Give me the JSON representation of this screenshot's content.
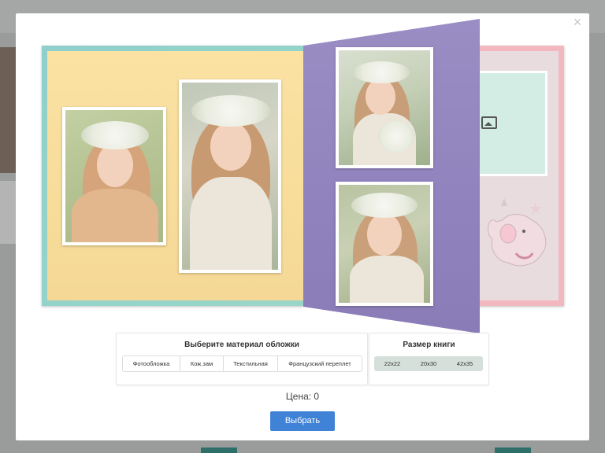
{
  "modal": {
    "close_glyph": "×"
  },
  "material": {
    "title": "Выберите материал обложки",
    "options": [
      "Фотообложка",
      "Кож.зам",
      "Текстильная",
      "Французский переплет"
    ]
  },
  "size": {
    "title": "Размер книги",
    "options": [
      "22x22",
      "20x30",
      "42x35"
    ]
  },
  "price_label": "Цена: 0",
  "choose_label": "Выбрать",
  "colors": {
    "primary_button": "#3f82d6",
    "left_page": "#fbe2a3",
    "flip_page": "#9a8dc4",
    "right_page_border": "#f3b7bf",
    "size_selector_bg": "#d6e0da"
  },
  "icons": {
    "close": "close-icon",
    "image_placeholder": "image-icon"
  }
}
